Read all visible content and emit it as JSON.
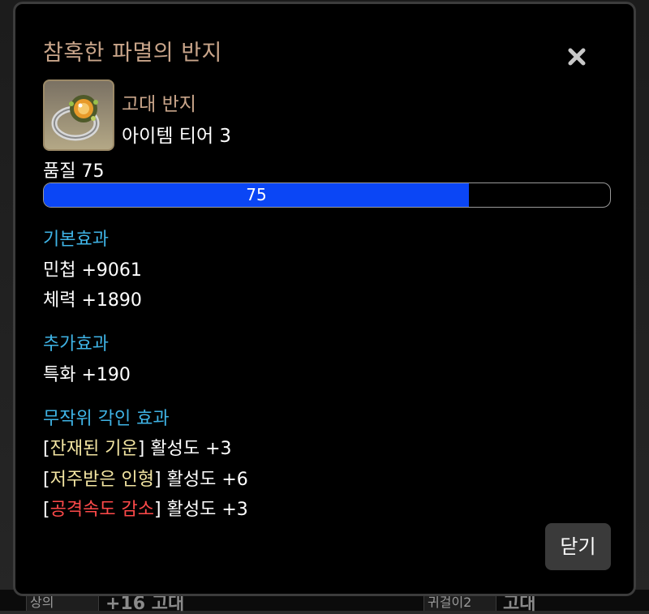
{
  "background": {
    "left_item_label": "상의",
    "left_item_text": "+16 고대",
    "right_item_label": "귀걸이2",
    "right_item_text": "고대"
  },
  "dialog": {
    "title": "참혹한 파멸의 반지",
    "close_icon": "close-x-icon",
    "item_icon": "ancient-ring-icon",
    "grade": "고대 반지",
    "tier": "아이템 티어 3",
    "quality_label": "품질 75",
    "quality_value": "75",
    "quality_percent": 75,
    "basic_effects_title": "기본효과",
    "basic_effects": [
      "민첩 +9061",
      "체력 +1890"
    ],
    "extra_effects_title": "추가효과",
    "extra_effects": [
      "특화 +190"
    ],
    "engraving_title": "무작위 각인 효과",
    "engravings": [
      {
        "name": "잔재된 기운",
        "level": "활성도 +3",
        "color": "#f3e5a2"
      },
      {
        "name": "저주받은 인형",
        "level": "활성도 +6",
        "color": "#f3e5a2"
      },
      {
        "name": "공격속도 감소",
        "level": "활성도 +3",
        "color": "#ff4a4a"
      }
    ],
    "close_button_label": "닫기"
  },
  "colors": {
    "title": "#c9a58a",
    "section": "#3fb4e6",
    "quality_bar": "#0b46f5",
    "engraving_positive": "#f3e5a2",
    "engraving_negative": "#ff4a4a"
  }
}
